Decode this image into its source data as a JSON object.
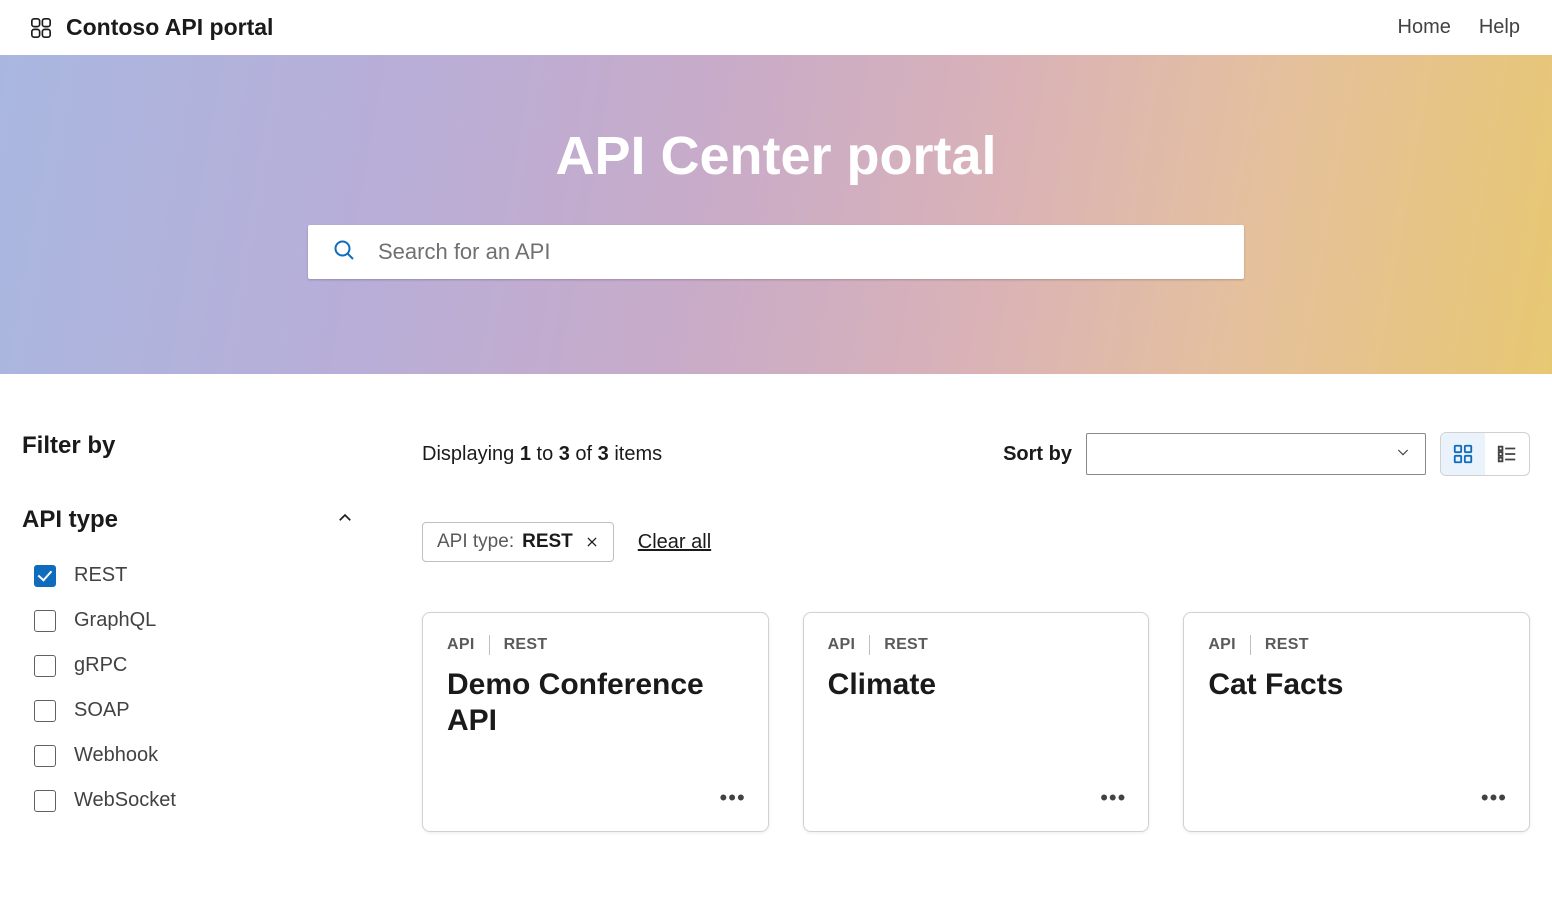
{
  "brand": "Contoso API portal",
  "nav": {
    "home": "Home",
    "help": "Help"
  },
  "hero": {
    "title": "API Center portal",
    "searchPlaceholder": "Search for an API"
  },
  "colors": {
    "accent": "#0f6cbd"
  },
  "filter": {
    "heading": "Filter by",
    "facet": {
      "title": "API type",
      "options": [
        {
          "label": "REST",
          "checked": true
        },
        {
          "label": "GraphQL",
          "checked": false
        },
        {
          "label": "gRPC",
          "checked": false
        },
        {
          "label": "SOAP",
          "checked": false
        },
        {
          "label": "Webhook",
          "checked": false
        },
        {
          "label": "WebSocket",
          "checked": false
        }
      ]
    }
  },
  "results": {
    "displaying": {
      "prefix": "Displaying ",
      "from": "1",
      "toWord": " to ",
      "to": "3",
      "ofWord": " of ",
      "total": "3",
      "suffix": " items"
    },
    "sortLabel": "Sort by",
    "sortValue": "",
    "chips": [
      {
        "key": "API type: ",
        "value": "REST"
      }
    ],
    "clearAll": "Clear all",
    "cards": [
      {
        "badge1": "API",
        "badge2": "REST",
        "title": "Demo Conference API"
      },
      {
        "badge1": "API",
        "badge2": "REST",
        "title": "Climate"
      },
      {
        "badge1": "API",
        "badge2": "REST",
        "title": "Cat Facts"
      }
    ]
  }
}
